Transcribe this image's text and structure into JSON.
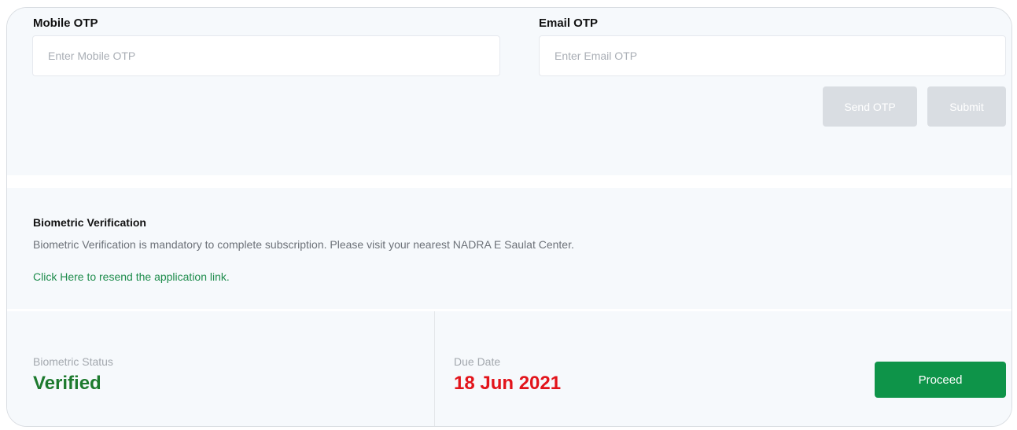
{
  "otp": {
    "mobile_label": "Mobile OTP",
    "mobile_placeholder": "Enter Mobile OTP",
    "email_label": "Email OTP",
    "email_placeholder": "Enter Email OTP",
    "send_otp_label": "Send OTP",
    "submit_label": "Submit"
  },
  "biometric": {
    "title": "Biometric Verification",
    "description": "Biometric Verification is mandatory to complete subscription. Please visit your nearest NADRA E Saulat Center.",
    "resend_link": "Click Here to resend the application link."
  },
  "status": {
    "status_label": "Biometric Status",
    "status_value": "Verified",
    "due_label": "Due Date",
    "due_value": "18 Jun 2021",
    "proceed_label": "Proceed"
  },
  "colors": {
    "verified": "#1d7a2e",
    "due_date": "#e2141b",
    "proceed_button": "#0e9449",
    "link": "#1e8c4c"
  }
}
